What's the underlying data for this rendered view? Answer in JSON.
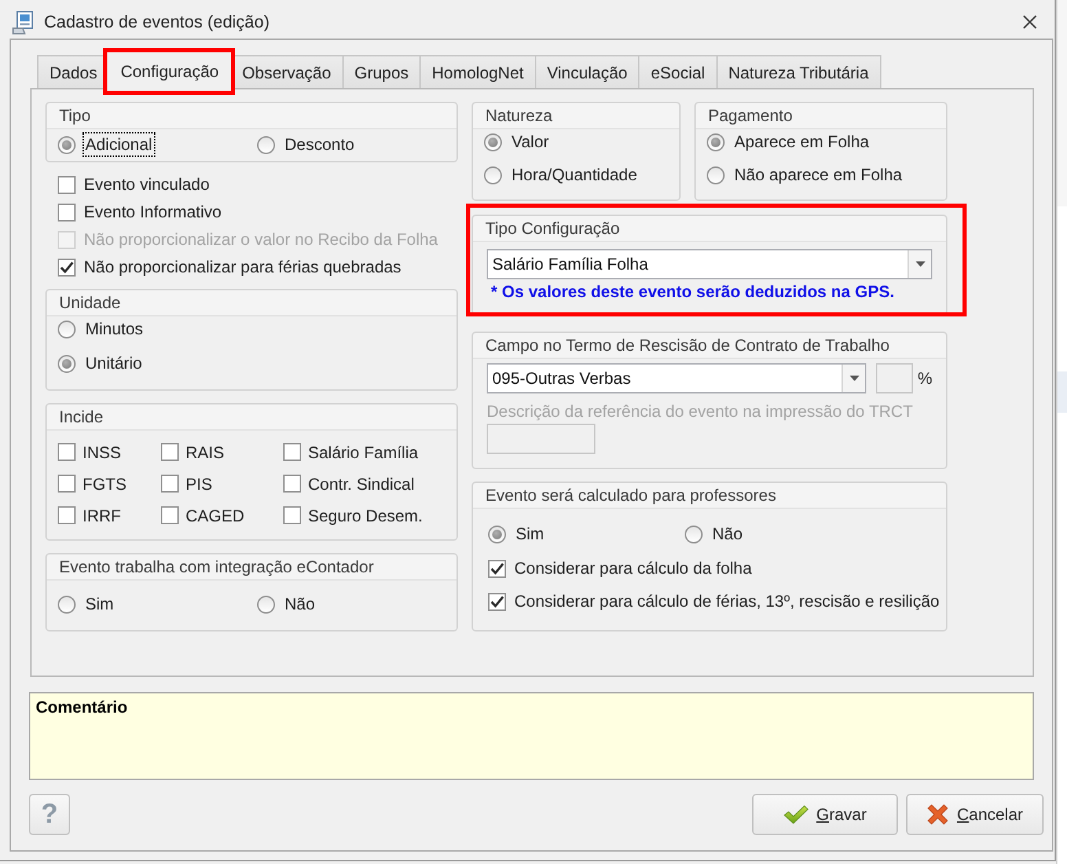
{
  "window": {
    "title": "Cadastro de eventos (edição)"
  },
  "tabs": [
    {
      "label": "Dados",
      "selected": false,
      "highlighted": false
    },
    {
      "label": "Configuração",
      "selected": true,
      "highlighted": true
    },
    {
      "label": "Observação",
      "selected": false,
      "highlighted": false
    },
    {
      "label": "Grupos",
      "selected": false,
      "highlighted": false
    },
    {
      "label": "HomologNet",
      "selected": false,
      "highlighted": false
    },
    {
      "label": "Vinculação",
      "selected": false,
      "highlighted": false
    },
    {
      "label": "eSocial",
      "selected": false,
      "highlighted": false
    },
    {
      "label": "Natureza Tributária",
      "selected": false,
      "highlighted": false
    }
  ],
  "tipo": {
    "title": "Tipo",
    "options": [
      {
        "label": "Adicional",
        "selected": true,
        "focused": true
      },
      {
        "label": "Desconto",
        "selected": false,
        "focused": false
      }
    ]
  },
  "flags": [
    {
      "label": "Evento vinculado",
      "checked": false,
      "disabled": false
    },
    {
      "label": "Evento Informativo",
      "checked": false,
      "disabled": false
    },
    {
      "label": "Não proporcionalizar o valor no Recibo da Folha",
      "checked": false,
      "disabled": true
    },
    {
      "label": "Não proporcionalizar para férias quebradas",
      "checked": true,
      "disabled": false
    }
  ],
  "unidade": {
    "title": "Unidade",
    "options": [
      {
        "label": "Minutos",
        "selected": false
      },
      {
        "label": "Unitário",
        "selected": true
      }
    ]
  },
  "incide": {
    "title": "Incide",
    "items": [
      {
        "label": "INSS",
        "checked": false
      },
      {
        "label": "RAIS",
        "checked": false
      },
      {
        "label": "Salário Família",
        "checked": false
      },
      {
        "label": "FGTS",
        "checked": false
      },
      {
        "label": "PIS",
        "checked": false
      },
      {
        "label": "Contr. Sindical",
        "checked": false
      },
      {
        "label": "IRRF",
        "checked": false
      },
      {
        "label": "CAGED",
        "checked": false
      },
      {
        "label": "Seguro Desem.",
        "checked": false
      }
    ]
  },
  "econtador": {
    "title": "Evento trabalha com integração eContador",
    "options": [
      {
        "label": "Sim",
        "selected": false
      },
      {
        "label": "Não",
        "selected": false
      }
    ]
  },
  "natureza": {
    "title": "Natureza",
    "options": [
      {
        "label": "Valor",
        "selected": true
      },
      {
        "label": "Hora/Quantidade",
        "selected": false
      }
    ]
  },
  "pagamento": {
    "title": "Pagamento",
    "options": [
      {
        "label": "Aparece em Folha",
        "selected": true
      },
      {
        "label": "Não aparece em Folha",
        "selected": false
      }
    ]
  },
  "tipo_configuracao": {
    "title": "Tipo Configuração",
    "highlighted": true,
    "value": "Salário Família Folha",
    "note": "* Os valores deste evento serão deduzidos na GPS."
  },
  "trct": {
    "title": "Campo no Termo de Rescisão de Contrato de Trabalho",
    "value": "095-Outras Verbas",
    "rate": {
      "unit": "%",
      "disabled": true
    },
    "description": {
      "label": "Descrição da referência do evento na impressão do TRCT",
      "disabled": true
    }
  },
  "professores": {
    "title": "Evento será calculado para professores",
    "options": [
      {
        "label": "Sim",
        "selected": true
      },
      {
        "label": "Não",
        "selected": false
      }
    ],
    "checks": [
      {
        "label": "Considerar para cálculo da folha",
        "checked": true
      },
      {
        "label": "Considerar para cálculo de férias, 13º, rescisão e resilição",
        "checked": true
      }
    ]
  },
  "comment": {
    "label": "Comentário"
  },
  "buttons": [
    {
      "kind": "help",
      "label": "?"
    },
    {
      "kind": "save",
      "label": "Gravar",
      "underline_first": true
    },
    {
      "kind": "cancel",
      "label": "Cancelar",
      "underline_first": true
    }
  ]
}
